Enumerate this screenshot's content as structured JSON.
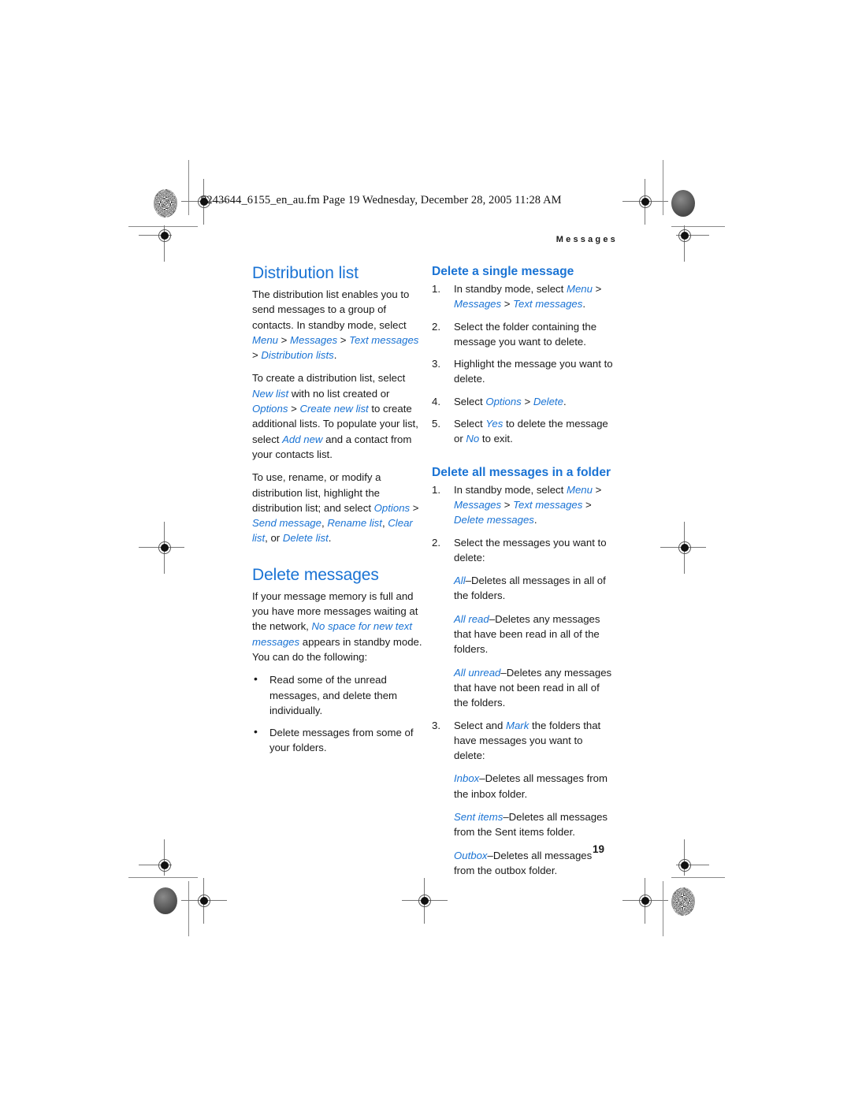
{
  "file_header": "9243644_6155_en_au.fm  Page 19  Wednesday, December 28, 2005  11:28 AM",
  "running_head": "Messages",
  "page_number": "19",
  "colors": {
    "accent_blue": "#1a73d4",
    "body_text": "#1a1a1a"
  },
  "left_column": {
    "section1": {
      "heading": "Distribution list",
      "paragraph1": {
        "part1": "The distribution list enables you to send messages to a group of contacts. In standby mode, select ",
        "ui1": "Menu",
        "sep1": " > ",
        "ui2": "Messages",
        "sep2": " > ",
        "ui3": "Text messages",
        "sep3": " > ",
        "ui4": "Distribution lists",
        "end": "."
      },
      "paragraph2": {
        "part1": "To create a distribution list, select ",
        "ui1": "New list",
        "part2": " with no list created or ",
        "ui2": "Options",
        "sep1": " > ",
        "ui3": "Create new list",
        "part3": " to create additional lists. To populate your list, select ",
        "ui4": "Add new",
        "part4": " and a contact from your contacts list."
      },
      "paragraph3": {
        "part1": "To use, rename, or modify a distribution list, highlight the distribution list; and select ",
        "ui1": "Options",
        "sep1": " > ",
        "ui2": "Send message",
        "comma1": ", ",
        "ui3": "Rename list",
        "comma2": ", ",
        "ui4": "Clear list",
        "comma3": ", or ",
        "ui5": "Delete list",
        "end": "."
      }
    },
    "section2": {
      "heading": "Delete messages",
      "paragraph1": {
        "part1": "If your message memory is full and you have more messages waiting at the network, ",
        "ui1": "No space for new text messages",
        "part2": " appears in standby mode. You can do the following:"
      },
      "bullets": [
        "Read some of the unread messages, and delete them individually.",
        "Delete messages from some of your folders."
      ]
    }
  },
  "right_column": {
    "section1": {
      "heading": "Delete a single message",
      "steps": [
        {
          "part1": "In standby mode, select ",
          "ui1": "Menu",
          "sep1": " > ",
          "ui2": "Messages",
          "sep2": " > ",
          "ui3": "Text messages",
          "end": "."
        },
        {
          "part1": "Select the folder containing the message you want to delete."
        },
        {
          "part1": "Highlight the message you want to delete."
        },
        {
          "part1": "Select ",
          "ui1": "Options",
          "sep1": " > ",
          "ui2": "Delete",
          "end": "."
        },
        {
          "part1": "Select ",
          "ui1": "Yes",
          "part2": " to delete the message or ",
          "ui2": "No",
          "part3": " to exit."
        }
      ]
    },
    "section2": {
      "heading": "Delete all messages in a folder",
      "step1": {
        "part1": "In standby mode, select ",
        "ui1": "Menu",
        "sep1": " > ",
        "ui2": "Messages",
        "sep2": " > ",
        "ui3": "Text messages",
        "sep3": " > ",
        "ui4": "Delete messages",
        "end": "."
      },
      "step2": {
        "part1": "Select the messages you want to delete:"
      },
      "step2_defs": [
        {
          "term": "All",
          "dash": "–",
          "desc": "Deletes all messages in all of the folders."
        },
        {
          "term": "All read",
          "dash": "–",
          "desc": "Deletes any messages that have been read in all of the folders."
        },
        {
          "term": "All unread",
          "dash": "–",
          "desc": "Deletes any messages that have not been read in all of the folders."
        }
      ],
      "step3": {
        "part1": "Select and ",
        "ui1": "Mark",
        "part2": " the folders that have messages you want to delete:"
      },
      "step3_defs": [
        {
          "term": "Inbox",
          "dash": "–",
          "desc": "Deletes all messages from the inbox folder."
        },
        {
          "term": "Sent items",
          "dash": "–",
          "desc": "Deletes all messages from the Sent items folder."
        },
        {
          "term": "Outbox",
          "dash": "–",
          "desc": "Deletes all messages from the outbox folder."
        }
      ]
    }
  }
}
